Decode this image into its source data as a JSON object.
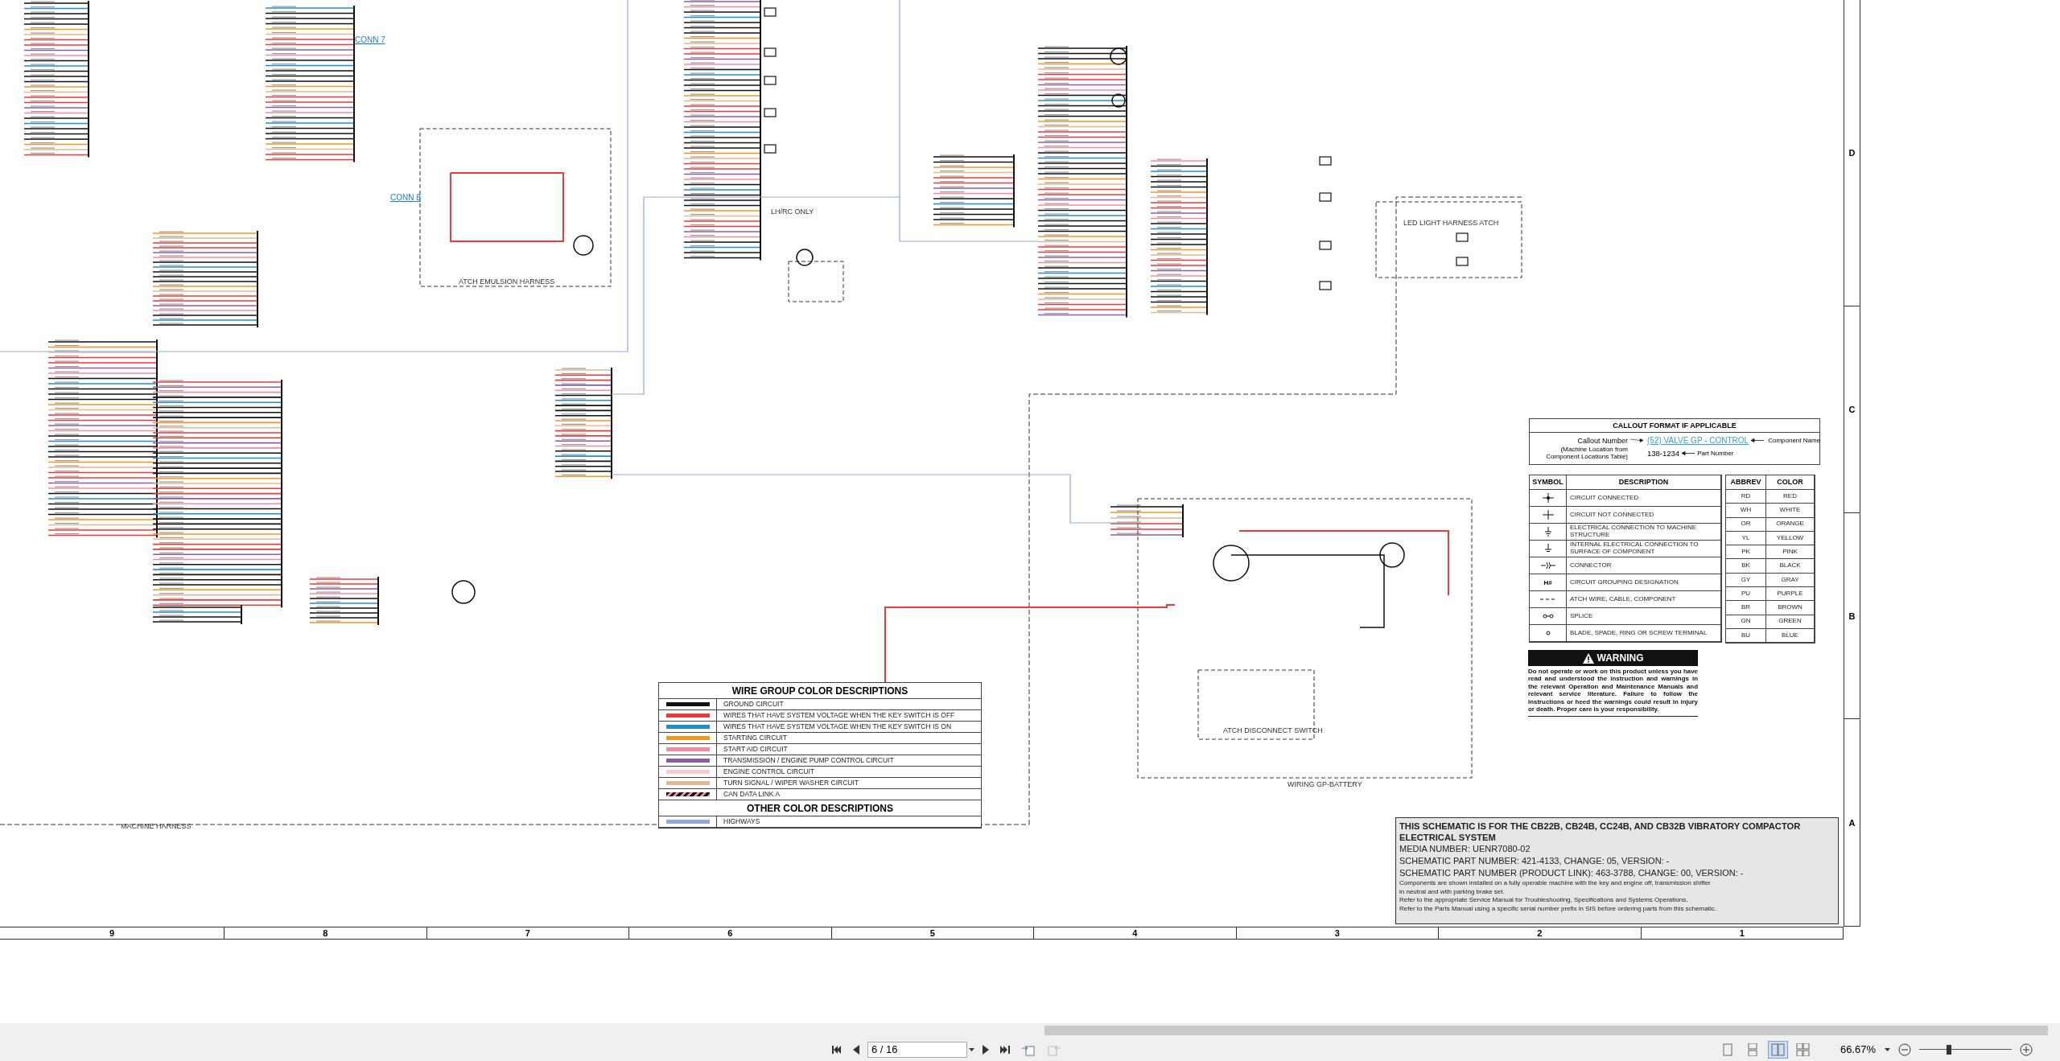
{
  "schematic_labels": [
    "CONN 7",
    "CONN 8",
    "ATCH EMULSION HARNESS",
    "LH/RC ONLY",
    "LED LIGHT HARNESS ATCH",
    "ATCH DISCONNECT SWITCH",
    "WIRING GP-BATTERY",
    "MACHINE HARNESS"
  ],
  "wire_legend": {
    "title": "WIRE GROUP COLOR DESCRIPTIONS",
    "entries": [
      {
        "kind": "solid",
        "color": "#111111",
        "label": "GROUND CIRCUIT"
      },
      {
        "kind": "solid",
        "color": "#ee3a36",
        "label": "WIRES THAT HAVE SYSTEM VOLTAGE WHEN THE KEY SWITCH IS OFF"
      },
      {
        "kind": "solid",
        "color": "#1b8fd2",
        "label": "WIRES THAT HAVE SYSTEM VOLTAGE WHEN THE KEY SWITCH IS ON"
      },
      {
        "kind": "solid",
        "color": "#f7941d",
        "label": "STARTING CIRCUIT"
      },
      {
        "kind": "solid",
        "color": "#f28ba2",
        "label": "START AID CIRCUIT"
      },
      {
        "kind": "solid",
        "color": "#8e5ba6",
        "label": "TRANSMISSION / ENGINE PUMP CONTROL CIRCUIT"
      },
      {
        "kind": "solid",
        "color": "#f9c9d4",
        "label": "ENGINE CONTROL CIRCUIT"
      },
      {
        "kind": "solid",
        "color": "#e3b992",
        "label": "TURN SIGNAL / WIPER WASHER CIRCUIT"
      },
      {
        "kind": "striped",
        "color": "#f28ba2",
        "label": "CAN DATA LINK A"
      }
    ],
    "other_title": "OTHER COLOR DESCRIPTIONS",
    "other_entries": [
      {
        "kind": "solid",
        "color": "#8fa9d8",
        "label": "HIGHWAYS"
      }
    ]
  },
  "callout": {
    "title": "CALLOUT FORMAT IF APPLICABLE",
    "callout_number": "Callout Number",
    "callout_note": "(Machine Location from Component Locations Table)",
    "component_link": "(52) VALVE GP - CONTROL",
    "component_name": "Component Name",
    "part_number": "138-1234",
    "part_label": "Part Number"
  },
  "symbol_table": {
    "columns": [
      "SYMBOL",
      "DESCRIPTION"
    ],
    "rows": [
      {
        "kind": "connected",
        "description": "CIRCUIT CONNECTED"
      },
      {
        "kind": "not-connected",
        "description": "CIRCUIT NOT CONNECTED"
      },
      {
        "kind": "ground",
        "description": "ELECTRICAL CONNECTION TO MACHINE STRUCTURE"
      },
      {
        "kind": "internal-ground",
        "description": "INTERNAL ELECTRICAL CONNECTION TO SURFACE OF COMPONENT"
      },
      {
        "kind": "connector",
        "description": "CONNECTOR"
      },
      {
        "kind": "text",
        "symbol": "H#",
        "description": "CIRCUIT GROUPING DESIGNATION"
      },
      {
        "kind": "dashed",
        "description": "ATCH WIRE, CABLE, COMPONENT"
      },
      {
        "kind": "splice",
        "description": "SPLICE"
      },
      {
        "kind": "terminal",
        "description": "BLADE, SPADE, RING OR SCREW TERMINAL"
      }
    ]
  },
  "abbrev_table": {
    "columns": [
      "ABBREV",
      "COLOR"
    ],
    "rows": [
      {
        "abbrev": "RD",
        "color_name": "RED"
      },
      {
        "abbrev": "WH",
        "color_name": "WHITE"
      },
      {
        "abbrev": "OR",
        "color_name": "ORANGE"
      },
      {
        "abbrev": "YL",
        "color_name": "YELLOW"
      },
      {
        "abbrev": "PK",
        "color_name": "PINK"
      },
      {
        "abbrev": "BK",
        "color_name": "BLACK"
      },
      {
        "abbrev": "GY",
        "color_name": "GRAY"
      },
      {
        "abbrev": "PU",
        "color_name": "PURPLE"
      },
      {
        "abbrev": "BR",
        "color_name": "BROWN"
      },
      {
        "abbrev": "GN",
        "color_name": "GREEN"
      },
      {
        "abbrev": "BU",
        "color_name": "BLUE"
      }
    ]
  },
  "warning": {
    "title": "WARNING",
    "text": "Do not operate or work on this product unless you have read and understood the instruction and warnings in the relevant Operation and Maintenance Manuals and relevant service literature. Failure to follow the instructions or heed the warnings could result in injury or death. Proper care is your responsibility."
  },
  "title_block": {
    "heading": "THIS SCHEMATIC IS FOR THE CB22B, CB24B, CC24B, AND CB32B VIBRATORY COMPACTOR ELECTRICAL SYSTEM",
    "lines": [
      "MEDIA NUMBER: UENR7080-02",
      "SCHEMATIC PART NUMBER: 421-4133, CHANGE: 05, VERSION: -",
      "SCHEMATIC PART NUMBER (PRODUCT LINK): 463-3788, CHANGE: 00, VERSION: -"
    ],
    "notes": [
      "Components are shown installed on a fully operable machine with the key and engine off, transmission shifter",
      "in neutral and with parking brake set.",
      "Refer to the appropriate Service Manual for Troubleshooting, Specifications and Systems Operations.",
      "Refer to the Parts Manual using a specific serial number prefix in SIS before ordering parts from this schematic."
    ]
  },
  "column_numbers": [
    "9",
    "8",
    "7",
    "6",
    "5",
    "4",
    "3",
    "2",
    "1"
  ],
  "row_letters": [
    "D",
    "C",
    "B",
    "A"
  ],
  "toolbar": {
    "page_field": "6 / 16",
    "view_modes": [
      {
        "kind": "single",
        "selected": false
      },
      {
        "kind": "continuous",
        "selected": false
      },
      {
        "kind": "facing",
        "selected": true
      },
      {
        "kind": "continuous-facing",
        "selected": false
      }
    ],
    "zoom_value": "66.67%",
    "zoom_slider": {
      "level": 0.32
    }
  }
}
